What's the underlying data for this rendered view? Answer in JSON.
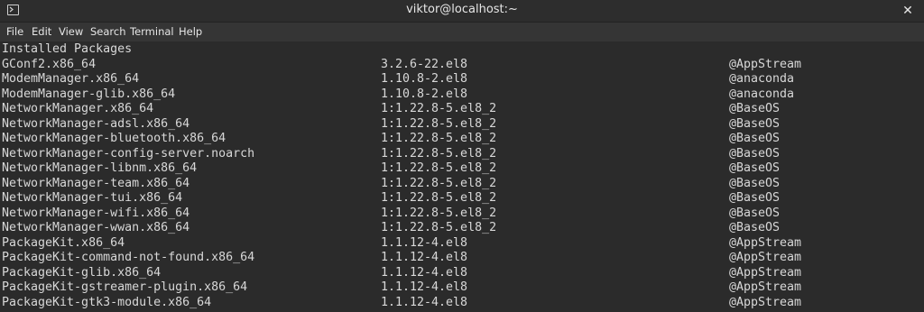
{
  "window": {
    "title": "viktor@localhost:~",
    "close_glyph": "✕",
    "icon": "terminal-icon"
  },
  "menu": [
    "File",
    "Edit",
    "View",
    "Search",
    "Terminal",
    "Help"
  ],
  "colors": {
    "background": "#2b2b2b",
    "titlebar": "#2d2d2d",
    "menubar": "#353535",
    "text": "#d8d8d8"
  },
  "terminal": {
    "header": "Installed Packages",
    "packages": [
      {
        "name": "GConf2.x86_64",
        "version": "3.2.6-22.el8",
        "repo": "@AppStream"
      },
      {
        "name": "ModemManager.x86_64",
        "version": "1.10.8-2.el8",
        "repo": "@anaconda"
      },
      {
        "name": "ModemManager-glib.x86_64",
        "version": "1.10.8-2.el8",
        "repo": "@anaconda"
      },
      {
        "name": "NetworkManager.x86_64",
        "version": "1:1.22.8-5.el8_2",
        "repo": "@BaseOS"
      },
      {
        "name": "NetworkManager-adsl.x86_64",
        "version": "1:1.22.8-5.el8_2",
        "repo": "@BaseOS"
      },
      {
        "name": "NetworkManager-bluetooth.x86_64",
        "version": "1:1.22.8-5.el8_2",
        "repo": "@BaseOS"
      },
      {
        "name": "NetworkManager-config-server.noarch",
        "version": "1:1.22.8-5.el8_2",
        "repo": "@BaseOS"
      },
      {
        "name": "NetworkManager-libnm.x86_64",
        "version": "1:1.22.8-5.el8_2",
        "repo": "@BaseOS"
      },
      {
        "name": "NetworkManager-team.x86_64",
        "version": "1:1.22.8-5.el8_2",
        "repo": "@BaseOS"
      },
      {
        "name": "NetworkManager-tui.x86_64",
        "version": "1:1.22.8-5.el8_2",
        "repo": "@BaseOS"
      },
      {
        "name": "NetworkManager-wifi.x86_64",
        "version": "1:1.22.8-5.el8_2",
        "repo": "@BaseOS"
      },
      {
        "name": "NetworkManager-wwan.x86_64",
        "version": "1:1.22.8-5.el8_2",
        "repo": "@BaseOS"
      },
      {
        "name": "PackageKit.x86_64",
        "version": "1.1.12-4.el8",
        "repo": "@AppStream"
      },
      {
        "name": "PackageKit-command-not-found.x86_64",
        "version": "1.1.12-4.el8",
        "repo": "@AppStream"
      },
      {
        "name": "PackageKit-glib.x86_64",
        "version": "1.1.12-4.el8",
        "repo": "@AppStream"
      },
      {
        "name": "PackageKit-gstreamer-plugin.x86_64",
        "version": "1.1.12-4.el8",
        "repo": "@AppStream"
      },
      {
        "name": "PackageKit-gtk3-module.x86_64",
        "version": "1.1.12-4.el8",
        "repo": "@AppStream"
      }
    ]
  }
}
